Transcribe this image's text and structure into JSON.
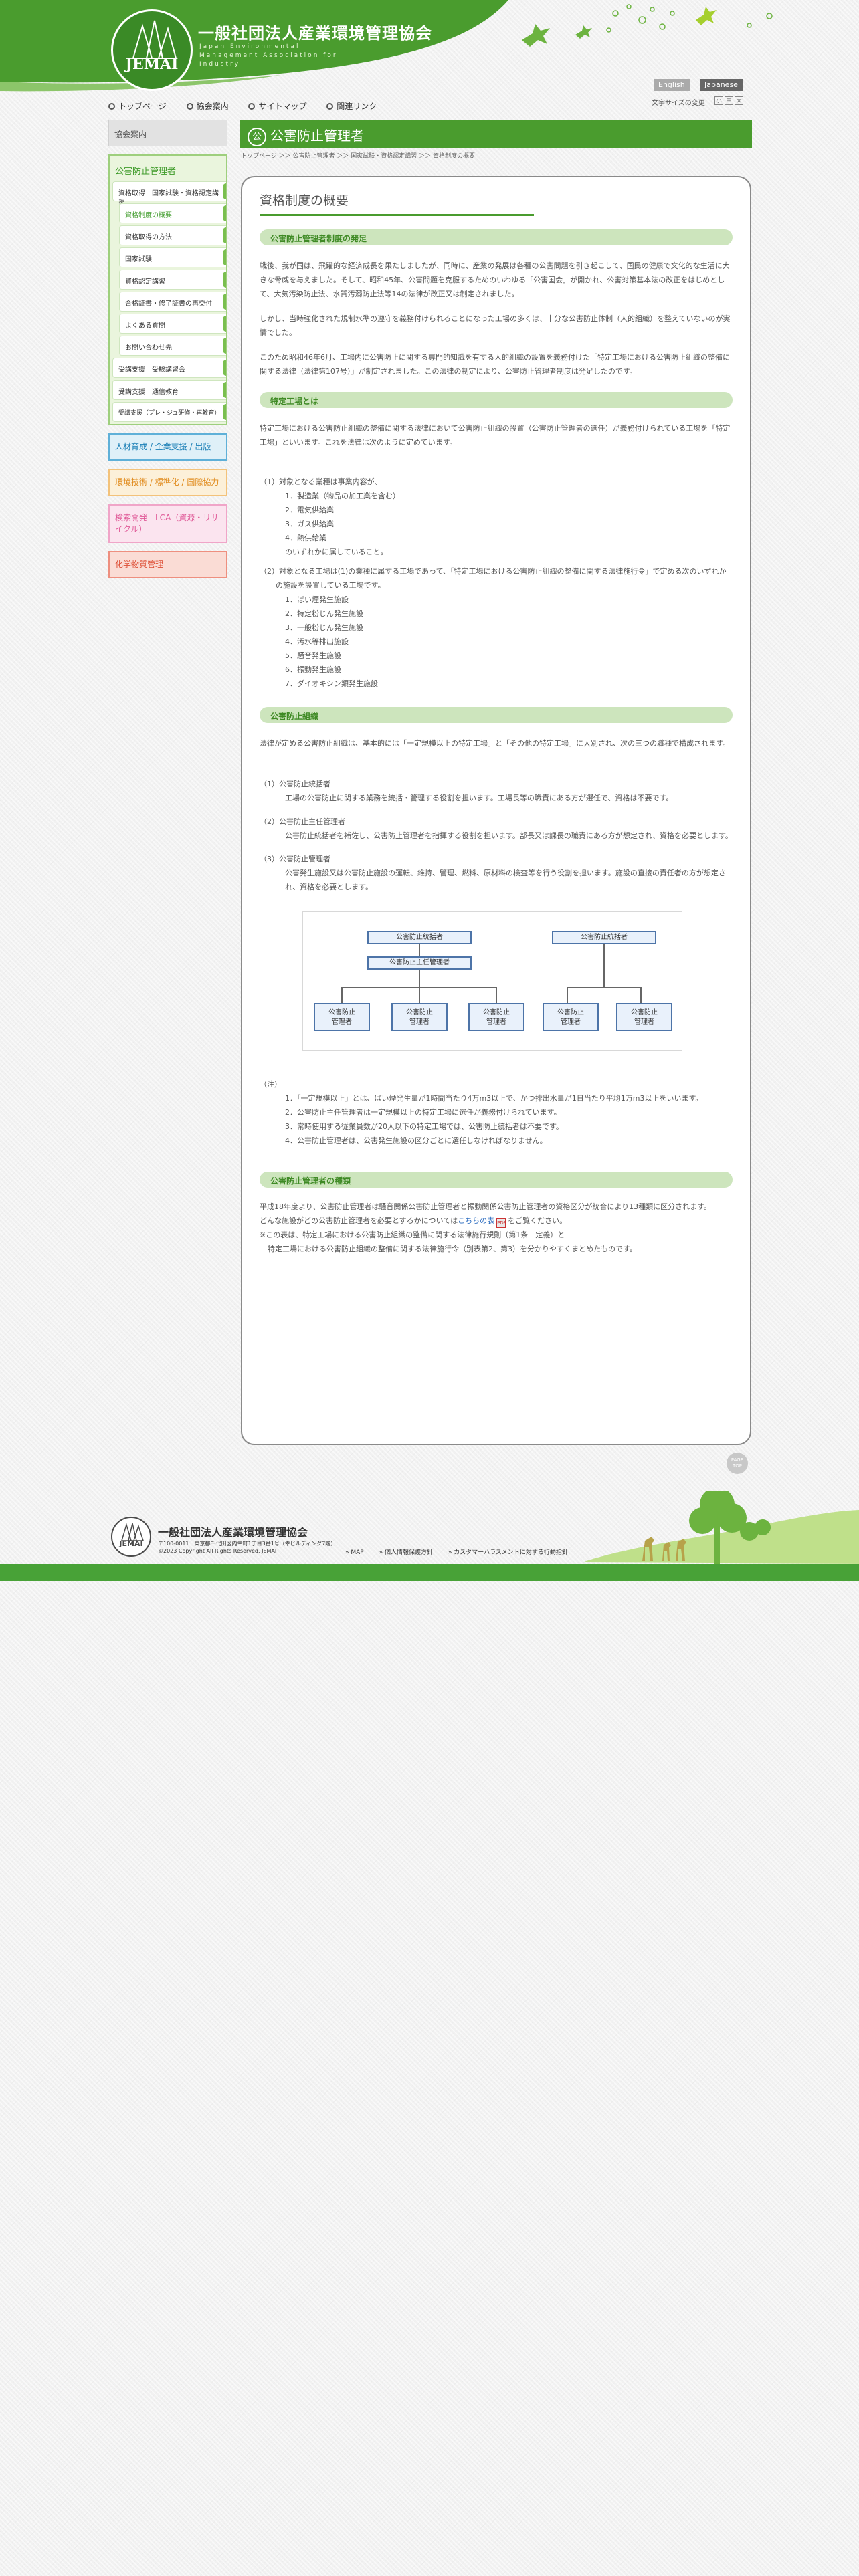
{
  "header": {
    "logo_mark": "JEMAI",
    "org_name": "一般社団法人産業環境管理協会",
    "org_name_en": "Japan Environmental Management Association for Industry",
    "lang_en": "English",
    "lang_ja": "Japanese",
    "font_size_label": "文字サイズの変更",
    "font_small": "小",
    "font_mid": "中",
    "font_large": "大"
  },
  "gnav": [
    {
      "label": "トップページ"
    },
    {
      "label": "協会案内"
    },
    {
      "label": "サイトマップ"
    },
    {
      "label": "関連リンク"
    }
  ],
  "sidebar": {
    "about": "協会案内",
    "green_head": "公害防止管理者",
    "items": [
      {
        "label": "資格取得　国家試験・資格認定講習"
      },
      {
        "label": "資格制度の概要"
      },
      {
        "label": "資格取得の方法"
      },
      {
        "label": "国家試験"
      },
      {
        "label": "資格認定講習"
      },
      {
        "label": "合格証書・修了証書の再交付"
      },
      {
        "label": "よくある質問"
      },
      {
        "label": "お問い合わせ先"
      },
      {
        "label": "受講支援　受験講習会"
      },
      {
        "label": "受講支援　通信教育"
      },
      {
        "label": "受講支援（プレ・ジュ研修・再教育）"
      }
    ],
    "box1": "人材育成 / 企業支援 / 出版",
    "box2": "環境技術 / 標準化 / 国際協力",
    "box3": "検索開発　LCA（資源・リサイクル）",
    "box4": "化学物質管理"
  },
  "page": {
    "title": "公害防止管理者",
    "title_icon": "公",
    "breadcrumb": "トップページ ＞＞ 公害防止管理者 ＞＞ 国家試験・資格認定講習 ＞＞ 資格制度の概要",
    "panel_title": "資格制度の概要"
  },
  "sections": {
    "s1": {
      "h": "公害防止管理者制度の発足",
      "p1": "戦後、我が国は、飛躍的な経済成長を果たしましたが、同時に、産業の発展は各種の公害問題を引き起こして、国民の健康で文化的な生活に大きな脅威を与えました。そして、昭和45年、公害問題を克服するためのいわゆる「公害国会」が開かれ、公害対策基本法の改正をはじめとして、大気汚染防止法、水質汚濁防止法等14の法律が改正又は制定されました。",
      "p2": "しかし、当時強化された規制水準の遵守を義務付けられることになった工場の多くは、十分な公害防止体制（人的組織）を整えていないのが実情でした。",
      "p3": "このため昭和46年6月、工場内に公害防止に関する専門的知識を有する人的組織の設置を義務付けた「特定工場における公害防止組織の整備に関する法律（法律第107号）」が制定されました。この法律の制定により、公害防止管理者制度は発足したのです。"
    },
    "s2": {
      "h": "特定工場とは",
      "p1": "特定工場における公害防止組織の整備に関する法律において公害防止組織の設置（公害防止管理者の選任）が義務付けられている工場を「特定工場」といいます。これを法律は次のように定めています。",
      "l1": "（1）対象となる業種は事業内容が、",
      "l1items": [
        "1．製造業（物品の加工業を含む）",
        "2．電気供給業",
        "3．ガス供給業",
        "4．熱供給業",
        "のいずれかに属していること。"
      ],
      "l2": "（2）対象となる工場は(1)の業種に属する工場であって、「特定工場における公害防止組織の整備に関する法律施行令」で定める次のいずれかの施設を設置している工場です。",
      "l2items": [
        "1．ばい煙発生施設",
        "2．特定粉じん発生施設",
        "3．一般粉じん発生施設",
        "4．汚水等排出施設",
        "5．騒音発生施設",
        "6．振動発生施設",
        "7．ダイオキシン類発生施設"
      ]
    },
    "s3": {
      "h": "公害防止組織",
      "p1": "法律が定める公害防止組織は、基本的には「一定規模以上の特定工場」と「その他の特定工場」に大別され、次の三つの職種で構成されます。",
      "r1t": "（1）公害防止統括者",
      "r1d": "工場の公害防止に関する業務を統括・管理する役割を担います。工場長等の職責にある方が選任で、資格は不要です。",
      "r2t": "（2）公害防止主任管理者",
      "r2d": "公害防止統括者を補佐し、公害防止管理者を指揮する役割を担います。部長又は課長の職責にある方が想定され、資格を必要とします。",
      "r3t": "（3）公害防止管理者",
      "r3d": "公害発生施設又は公害防止施設の運転、維持、管理、燃料、原材料の検査等を行う役割を担います。施設の直接の責任者の方が想定され、資格を必要とします。",
      "org": {
        "top_a": "公害防止統括者",
        "top_b": "公害防止統括者",
        "mid": "公害防止主任管理者",
        "mgr": "公害防止\n管理者"
      },
      "note_head": "（注）",
      "notes": [
        "1．「一定規模以上」とは、ばい煙発生量が1時間当たり4万m3以上で、かつ排出水量が1日当たり平均1万m3以上をいいます。",
        "2．公害防止主任管理者は一定規模以上の特定工場に選任が義務付けられています。",
        "3．常時使用する従業員数が20人以下の特定工場では、公害防止統括者は不要です。",
        "4．公害防止管理者は、公害発生施設の区分ごとに選任しなければなりません。"
      ]
    },
    "s4": {
      "h": "公害防止管理者の種類",
      "p1": "平成18年度より、公害防止管理者は騒音関係公害防止管理者と振動関係公害防止管理者の資格区分が統合により13種類に区分されます。",
      "p2a": "どんな施設がどの公害防止管理者を必要とするかについては",
      "p2link": "こちらの表",
      "p2b": "をご覧ください。",
      "p3": "※この表は、特定工場における公害防止組織の整備に関する法律施行規則（第1条　定義）と",
      "p4": "特定工場における公害防止組織の整備に関する法律施行令（別表第2、第3）を分かりやすくまとめたものです。"
    }
  },
  "pagetop": "PAGE TOP",
  "footer": {
    "name": "一般社団法人産業環境管理協会",
    "addr1": "〒100-0011　東京都千代田区内幸町1丁目3番1号（幸ビルディング7階）",
    "copy": "©2023 Copyright  All Rights Reserved. JEMAI",
    "links": [
      "MAP",
      "個人情報保護方針",
      "カスタマーハラスメントに対する行動指針"
    ]
  }
}
